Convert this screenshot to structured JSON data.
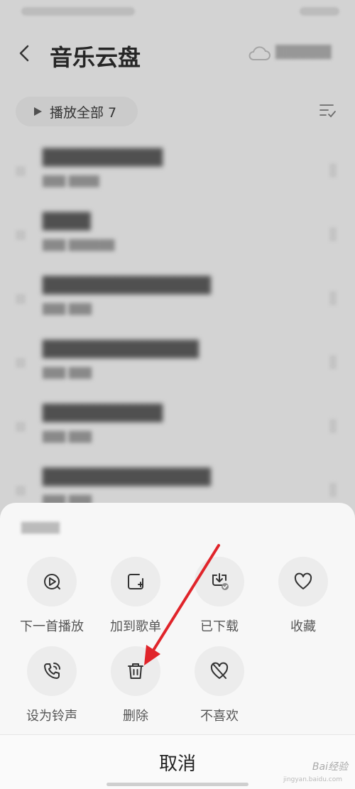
{
  "header": {
    "title": "音乐云盘"
  },
  "toolbar": {
    "play_all_label": "播放全部 7"
  },
  "songs": [
    {
      "title": "██████████",
      "sub": "███ ████"
    },
    {
      "title": "████",
      "sub": "███ ██████"
    },
    {
      "title": "██████████████",
      "sub": "███ ███"
    },
    {
      "title": "█████████████",
      "sub": "███ ███"
    },
    {
      "title": "██████████",
      "sub": "███ ███"
    },
    {
      "title": "██████████████",
      "sub": "███ ███"
    }
  ],
  "sheet": {
    "actions": [
      {
        "label": "下一首播放",
        "icon": "play-next-icon"
      },
      {
        "label": "加到歌单",
        "icon": "add-to-playlist-icon"
      },
      {
        "label": "已下载",
        "icon": "downloaded-icon"
      },
      {
        "label": "收藏",
        "icon": "heart-icon"
      },
      {
        "label": "设为铃声",
        "icon": "ringtone-icon"
      },
      {
        "label": "删除",
        "icon": "trash-icon"
      },
      {
        "label": "不喜欢",
        "icon": "dislike-icon"
      }
    ],
    "cancel_label": "取消"
  },
  "watermark": {
    "text": "Bai经验",
    "sub": "jingyan.baidu.com"
  },
  "colors": {
    "arrow": "#e0242a",
    "sheet_bg": "#f7f7f7",
    "circle_bg": "#ececec"
  }
}
